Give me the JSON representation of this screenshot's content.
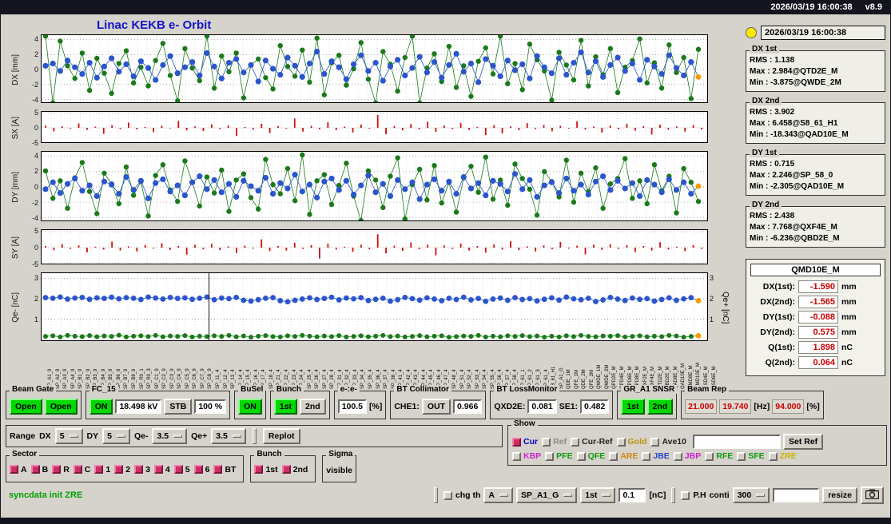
{
  "titlebar": {
    "datetime": "2026/03/19 16:00:38",
    "version": "v8.9"
  },
  "header": {
    "title": "Linac KEKB e- Orbit",
    "timestamp": "2026/03/19 16:00:38"
  },
  "stats": [
    {
      "label": "DX 1st",
      "rms": "RMS : 1.138",
      "max": "Max : 2.984@QTD2E_M",
      "min": "Min : -3.875@QWDE_2M"
    },
    {
      "label": "DX 2nd",
      "rms": "RMS : 3.902",
      "max": "Max : 6.458@S8_61_H1",
      "min": "Min : -18.343@QAD10E_M"
    },
    {
      "label": "DY 1st",
      "rms": "RMS : 0.715",
      "max": "Max : 2.246@SP_58_0",
      "min": "Min : -2.305@QAD10E_M"
    },
    {
      "label": "DY 2nd",
      "rms": "RMS : 2.438",
      "max": "Max : 7.768@QXF4E_M",
      "min": "Min : -6.236@QBD2E_M"
    }
  ],
  "monitor": {
    "name": "QMD10E_M",
    "rows": [
      {
        "label": "DX(1st):",
        "value": "-1.590",
        "unit": "mm"
      },
      {
        "label": "DX(2nd):",
        "value": "-1.565",
        "unit": "mm"
      },
      {
        "label": "DY(1st):",
        "value": "-0.088",
        "unit": "mm"
      },
      {
        "label": "DY(2nd):",
        "value": "0.575",
        "unit": "mm"
      },
      {
        "label": "Q(1st):",
        "value": "1.898",
        "unit": "nC"
      },
      {
        "label": "Q(2nd):",
        "value": "0.064",
        "unit": "nC"
      }
    ]
  },
  "controls": {
    "beam_gate": {
      "label": "Beam Gate",
      "open1": "Open",
      "open2": "Open"
    },
    "fc15": {
      "label": "FC_15",
      "on": "ON",
      "kv": "18.498 kV",
      "stb": "STB",
      "pct": "100 %"
    },
    "busel": {
      "label": "BuSel",
      "on": "ON"
    },
    "bunch_sel": {
      "label": "Bunch",
      "b1": "1st",
      "b2": "2nd"
    },
    "ee": {
      "label": "e-:e-",
      "value": "100.5",
      "unit": "[%]"
    },
    "bt_collimator": {
      "label": "BT Collimator",
      "che1": "CHE1:",
      "out": "OUT",
      "value": "0.966"
    },
    "bt_loss": {
      "label": "BT LossMonitor",
      "qxd2e": "QXD2E:",
      "qxd2e_value": "0.081",
      "se1": "SE1:",
      "se1_value": "0.482"
    },
    "gr_snsr": {
      "label": "GR_A1 SNSR",
      "b1": "1st",
      "b2": "2nd"
    },
    "beam_rep": {
      "label": "Beam Rep",
      "v1": "21.000",
      "v2": "19.740",
      "hz": "[Hz]",
      "v3": "94.000",
      "pct": "[%]"
    },
    "range": {
      "label": "Range",
      "dx_label": "DX",
      "dx": "5",
      "dy_label": "DY",
      "dy": "5",
      "qem_label": "Qe-",
      "qem": "3.5",
      "qep_label": "Qe+",
      "qep": "3.5",
      "replot": "Replot"
    },
    "sector": {
      "label": "Sector",
      "items": [
        "A",
        "B",
        "R",
        "C",
        "1",
        "2",
        "3",
        "4",
        "5",
        "6",
        "BT"
      ]
    },
    "bunch_chk": {
      "label": "Bunch",
      "items": [
        "1st",
        "2nd"
      ]
    },
    "sigma": {
      "label": "Sigma",
      "visible": "visible"
    },
    "show": {
      "label": "Show",
      "row1": [
        {
          "label": "Cur",
          "color": "#0000cc",
          "checked": true
        },
        {
          "label": "Ref",
          "color": "#8a8a8a"
        },
        {
          "label": "Cur-Ref",
          "color": "#222222"
        },
        {
          "label": "Gold",
          "color": "#b8960c"
        },
        {
          "label": "Ave10",
          "color": "#222222"
        }
      ],
      "set_ref": "Set Ref",
      "row2": [
        {
          "label": "KBP",
          "color": "#cc22cc"
        },
        {
          "label": "PFE",
          "color": "#119911"
        },
        {
          "label": "QFE",
          "color": "#119911"
        },
        {
          "label": "ARE",
          "color": "#cc8811"
        },
        {
          "label": "JBE",
          "color": "#2244cc"
        },
        {
          "label": "JBP",
          "color": "#cc22cc"
        },
        {
          "label": "RFE",
          "color": "#119911"
        },
        {
          "label": "SFE",
          "color": "#119911"
        },
        {
          "label": "ZRE",
          "color": "#c8b400"
        }
      ]
    }
  },
  "statusbar": {
    "message": "syncdata init ZRE",
    "chg_th_label": "chg th",
    "monitor_select": "A",
    "device_select": "SP_A1_G",
    "bunch_select": "1st",
    "threshold": "0.1",
    "threshold_unit": "[nC]",
    "ph_label": "P.H",
    "conti_label": "conti",
    "count_select": "300",
    "resize_label": "resize"
  },
  "xaxis_labels": [
    "SP_A1_9",
    "SP_A2_9",
    "SP_A3_9",
    "SP_A4_9",
    "SP_B1_9",
    "SP_B2_9",
    "SP_B3_9",
    "SP_B4_9",
    "SP_B5_9",
    "SP_B6_9",
    "SP_B7_9",
    "SP_B8_9",
    "SP_R0_1",
    "SP_R0_3",
    "SP_C1_9",
    "SP_C2_9",
    "SP_C3_9",
    "SP_C4_9",
    "SP_C5_9",
    "SP_C6_9",
    "SP_C7_9",
    "SP_C8_9",
    "SP_11_4",
    "SP_12_4",
    "SP_13_4",
    "SP_14_4",
    "SP_15_4",
    "SP_16_4",
    "SP_17_4",
    "SP_18_4",
    "SP_21_4",
    "SP_22_4",
    "SP_23_4",
    "SP_24_4",
    "SP_25_4",
    "SP_26_4",
    "SP_27_4",
    "SP_28_4",
    "SP_31_4",
    "SP_32_4",
    "SP_33_4",
    "SP_34_4",
    "SP_35_4",
    "SP_36_4",
    "SP_37_4",
    "SP_38_4",
    "SP_41_4",
    "SP_42_4",
    "SP_43_4",
    "SP_44_4",
    "SP_45_4",
    "SP_46_4",
    "SP_47_4",
    "SP_48_4",
    "SP_51_4",
    "SP_52_4",
    "SP_53_4",
    "SP_54_4",
    "SP_55_4",
    "SP_56_4",
    "SP_57_4",
    "SP_58_4",
    "SP_61_1",
    "SP_61_2",
    "SP_61_3",
    "SP_61_4",
    "S8_61_H1",
    "SP_A1_G",
    "QDE_1M",
    "QFE_1M",
    "QDE_2M",
    "QFE_2M",
    "QWDE_1M",
    "QWDE_2M",
    "QPD2E_M",
    "QPD4E_M",
    "QPD6E_M",
    "QPD8E_M",
    "QXF2E_M",
    "QXF4E_M",
    "QTD2E_M",
    "QBD2E_M",
    "QAD8E_M",
    "QAD10E_M",
    "QMD8E_M",
    "QMD10E_M",
    "QSD4E_M",
    "QSD6E_M"
  ],
  "chart_data": [
    {
      "id": "dx",
      "type": "line-scatter",
      "ylabel": "DX [mm]",
      "ylim": [
        -4.6,
        4.6
      ],
      "yticks": [
        4,
        2,
        0,
        -2,
        -4
      ],
      "series": [
        {
          "name": "DX 2nd",
          "color": "#1a7a1a",
          "marker": 3.2,
          "values": [
            4.5,
            -4.5,
            3.8,
            0.5,
            -1.2,
            2.2,
            -2.8,
            1.5,
            -0.5,
            -3.2,
            0.8,
            2.5,
            -1.8,
            0.3,
            -2.2,
            1.2,
            3.5,
            -0.8,
            -4.2,
            2.8,
            0.2,
            -1.5,
            4.5,
            -2.5,
            1.8,
            -0.3,
            2.2,
            -3.8,
            0.6,
            1.4,
            -1.1,
            -2.6,
            3.2,
            0.4,
            -0.9,
            2.6,
            -1.7,
            4.2,
            -3.4,
            0.9,
            1.9,
            -2.1,
            0.1,
            3.6,
            -1.3,
            -4.5,
            2.4,
            0.7,
            -2.9,
            1.6,
            4.5,
            -4.5,
            0.2,
            2.1,
            -1.6,
            3.1,
            -2.4,
            0.5,
            -3.6,
            1.1,
            2.9,
            -0.6,
            4.5,
            -1.9,
            0.8,
            -2.7,
            3.4,
            1.3,
            -0.2,
            -4.1,
            2.3,
            0.6,
            -1.4,
            3.9,
            -2.2,
            1.7,
            -0.7,
            2.8,
            -3.1,
            0.3,
            1.2,
            4.1,
            -1.8,
            0.9,
            -2.5,
            3.3,
            -0.4,
            1.6,
            -3.9,
            2.7
          ]
        },
        {
          "name": "DX 1st",
          "color": "#2a55cc",
          "marker": 3.6,
          "end_orange": true,
          "values": [
            0.5,
            0.8,
            -0.2,
            1.2,
            0.3,
            -0.6,
            0.9,
            -1.1,
            0.4,
            1.5,
            -0.3,
            0.7,
            -0.9,
            1.1,
            0.2,
            -1.4,
            0.6,
            1.8,
            -0.5,
            0.3,
            1.0,
            -0.8,
            2.2,
            0.4,
            -1.2,
            0.9,
            1.4,
            -0.4,
            0.6,
            -1.6,
            1.2,
            0.1,
            -0.7,
            1.6,
            0.5,
            -1.0,
            0.8,
            2.4,
            -0.6,
            1.1,
            0.3,
            -1.3,
            0.7,
            1.9,
            -0.2,
            0.9,
            -1.5,
            0.4,
            1.3,
            -0.8,
            0.2,
            1.7,
            -0.4,
            1.0,
            -1.1,
            0.6,
            2.1,
            -0.3,
            0.8,
            -1.7,
            1.4,
            0.5,
            -0.9,
            1.2,
            -0.1,
            0.7,
            -1.2,
            1.8,
            0.3,
            -0.5,
            1.5,
            -0.7,
            0.9,
            2.3,
            -0.4,
            1.1,
            -1.0,
            0.6,
            1.6,
            -0.2,
            0.8,
            -1.4,
            1.3,
            0.4,
            -0.6,
            1.9,
            0.2,
            -0.8,
            1.0,
            -1.0
          ]
        }
      ]
    },
    {
      "id": "sx",
      "type": "bar",
      "ylabel": "SX [A]",
      "ylim": [
        -5.5,
        5.5
      ],
      "yticks": [
        5,
        0,
        -5
      ],
      "color": "#cc1111",
      "values": [
        0.8,
        -1.2,
        0.5,
        -0.3,
        1.5,
        -0.7,
        0.4,
        -2.1,
        0.9,
        -0.4,
        1.8,
        -0.6,
        0.3,
        -1.5,
        0.7,
        -0.2,
        2.4,
        -0.9,
        0.5,
        -1.1,
        1.2,
        -0.4,
        0.8,
        -2.8,
        0.3,
        -0.6,
        1.4,
        -1.8,
        0.6,
        -0.3,
        3.2,
        -1.3,
        0.7,
        -0.5,
        1.9,
        -0.8,
        0.4,
        -1.6,
        1.1,
        -0.3,
        4.4,
        -2.2,
        0.6,
        -0.9,
        1.3,
        -0.5,
        2.1,
        -1.4,
        0.8,
        -0.4,
        1.7,
        -0.7,
        0.3,
        -2.5,
        0.9,
        -1.9,
        0.5,
        -0.8,
        1.6,
        -0.4,
        1.0,
        -1.2,
        0.7,
        -0.3,
        2.2,
        -0.6,
        0.4,
        -1.7,
        0.8,
        -0.5,
        1.4,
        -1.0,
        0.6,
        -2.3,
        1.1,
        -0.7,
        0.5,
        -1.3,
        0.9,
        -0.6
      ]
    },
    {
      "id": "dy",
      "type": "line-scatter",
      "ylabel": "DY [mm]",
      "ylim": [
        -4.6,
        4.6
      ],
      "yticks": [
        4,
        2,
        0,
        -2,
        -4
      ],
      "series": [
        {
          "name": "DY 2nd",
          "color": "#1a7a1a",
          "marker": 3.2,
          "values": [
            2.1,
            -1.5,
            0.8,
            -2.8,
            1.2,
            3.2,
            -0.6,
            -3.5,
            1.8,
            0.4,
            -2.2,
            2.6,
            -1.1,
            0.7,
            -3.8,
            1.5,
            2.9,
            -0.4,
            -1.9,
            3.4,
            0.6,
            -2.5,
            1.3,
            -0.8,
            2.2,
            -3.2,
            0.9,
            1.7,
            -1.4,
            -2.9,
            3.6,
            0.3,
            -0.9,
            2.4,
            -1.8,
            4.2,
            -3.6,
            0.8,
            1.6,
            -2.3,
            0.2,
            3.1,
            -1.2,
            -4.4,
            2.1,
            0.9,
            -2.7,
            1.4,
            3.8,
            -4.2,
            0.3,
            2.3,
            -1.7,
            2.8,
            -2.1,
            0.6,
            -3.3,
            1.2,
            2.7,
            -0.7,
            3.9,
            -1.6,
            0.9,
            -2.4,
            3.0,
            1.1,
            -0.3,
            -3.7,
            2.0,
            0.7,
            -1.3,
            3.5,
            -2.0,
            1.8,
            -0.6,
            2.5,
            -2.8,
            0.4,
            1.1,
            3.7,
            -1.5,
            0.8,
            -2.2,
            2.9,
            -0.5,
            1.4,
            -3.4,
            2.4,
            0.6,
            -1.9
          ]
        },
        {
          "name": "DY 1st",
          "color": "#2a55cc",
          "marker": 3.6,
          "end_orange": true,
          "values": [
            -0.3,
            0.6,
            -0.8,
            0.4,
            1.1,
            -0.5,
            0.2,
            -1.2,
            0.7,
            0.3,
            -0.9,
            1.3,
            -0.4,
            0.8,
            -1.5,
            0.5,
            1.0,
            -0.6,
            0.2,
            -1.1,
            0.6,
            1.4,
            -0.3,
            0.9,
            -0.7,
            0.4,
            -1.3,
            0.8,
            0.1,
            -0.5,
            1.2,
            -0.9,
            0.5,
            -0.2,
            1.6,
            -0.6,
            0.3,
            -1.4,
            0.7,
            1.1,
            -0.4,
            0.8,
            -1.0,
            0.2,
            1.5,
            -0.7,
            0.4,
            -1.2,
            0.9,
            -0.3,
            0.6,
            -1.6,
            0.3,
            1.0,
            -0.5,
            0.7,
            -0.9,
            1.3,
            -0.2,
            0.5,
            -1.1,
            0.8,
            0.4,
            -0.6,
            1.7,
            -0.3,
            0.9,
            -1.3,
            0.2,
            0.6,
            -0.8,
            1.1,
            -0.5,
            0.3,
            -1.0,
            0.7,
            1.4,
            -0.4,
            0.8,
            -0.2,
            0.5,
            -1.2,
            0.9,
            0.3,
            -0.7,
            1.0,
            -0.4,
            0.6,
            -0.9,
            0.1
          ]
        }
      ]
    },
    {
      "id": "sy",
      "type": "bar",
      "ylabel": "SY [A]",
      "ylim": [
        -5.5,
        5.5
      ],
      "yticks": [
        5,
        0,
        -5
      ],
      "color": "#cc1111",
      "values": [
        0.5,
        -0.8,
        1.1,
        -0.4,
        0.7,
        -1.5,
        0.3,
        -0.6,
        1.9,
        -0.9,
        0.4,
        -1.2,
        0.8,
        -0.3,
        1.4,
        -0.7,
        0.5,
        -2.2,
        0.9,
        -0.5,
        1.2,
        -0.8,
        0.4,
        -1.7,
        0.6,
        -0.3,
        2.6,
        -1.1,
        0.5,
        -0.9,
        1.5,
        -0.4,
        0.8,
        -3.4,
        1.2,
        -0.6,
        0.3,
        -1.3,
        0.9,
        -0.5,
        4.2,
        -1.8,
        0.6,
        -1.0,
        1.6,
        -0.5,
        0.9,
        -2.4,
        0.7,
        -0.4,
        1.3,
        -0.9,
        0.5,
        -1.6,
        1.0,
        -0.6,
        2.0,
        -0.8,
        0.4,
        -1.2,
        0.7,
        -0.5,
        1.8,
        -0.3,
        0.6,
        -2.1,
        0.9,
        -0.7,
        1.1,
        -0.4,
        0.8,
        -1.4,
        0.5,
        -0.9,
        1.7,
        -0.6,
        0.3,
        -1.1,
        0.8,
        -0.4
      ]
    },
    {
      "id": "q",
      "type": "line-scatter",
      "ylabel": "Qe- [nC]",
      "ylabel_right": "Qe+ [nC]",
      "ylim": [
        -0.12,
        3.25
      ],
      "yticks": [
        3,
        2,
        1
      ],
      "yticks_right": [
        3,
        2,
        1
      ],
      "cursor_x": 0.251,
      "series": [
        {
          "name": "Qe- 1st",
          "color": "#2a55cc",
          "marker": 3.4,
          "end_orange": true,
          "values": [
            2.05,
            2.02,
            2.08,
            1.98,
            2.03,
            2.06,
            1.97,
            2.04,
            2.01,
            2.07,
            1.99,
            2.05,
            2.02,
            1.96,
            2.08,
            2.03,
            1.98,
            2.06,
            2.01,
            2.04,
            1.97,
            2.02,
            2.08,
            1.95,
            2.03,
            2.0,
            2.06,
            1.92,
            1.88,
            1.95,
            2.02,
            2.05,
            1.9,
            1.85,
            1.92,
            1.98,
            2.04,
            1.96,
            2.01,
            2.07,
            1.94,
            2.03,
            1.99,
            2.05,
            1.91,
            1.97,
            2.02,
            1.88,
            1.95,
            2.06,
            2.0,
            1.93,
            2.04,
            1.98,
            1.9,
            2.02,
            1.96,
            2.07,
            1.94,
            2.01,
            1.87,
            1.98,
            2.03,
            1.92,
            2.05,
            1.96,
            2.0,
            1.89,
            1.97,
            2.04,
            1.93,
            2.08,
            1.99,
            1.95,
            2.02,
            1.86,
            1.94,
            2.06,
            1.98,
            1.91,
            2.03,
            1.97,
            2.0,
            1.88,
            1.96,
            2.04,
            1.92,
            1.99,
            2.05,
            1.9
          ]
        },
        {
          "name": "Qe- 2nd",
          "color": "#1a7a1a",
          "marker": 3.0,
          "end_orange": true,
          "values": [
            0.15,
            0.18,
            0.12,
            0.2,
            0.16,
            0.14,
            0.19,
            0.13,
            0.17,
            0.15,
            0.21,
            0.12,
            0.16,
            0.18,
            0.14,
            0.2,
            0.13,
            0.17,
            0.15,
            0.19,
            0.12,
            0.16,
            0.14,
            0.18,
            0.15,
            0.2,
            0.13,
            0.17,
            0.11,
            0.16,
            0.19,
            0.14,
            0.12,
            0.18,
            0.15,
            0.2,
            0.16,
            0.13,
            0.17,
            0.14,
            0.19,
            0.12,
            0.15,
            0.18,
            0.13,
            0.16,
            0.2,
            0.14,
            0.17,
            0.12,
            0.15,
            0.19,
            0.13,
            0.16,
            0.18,
            0.11,
            0.14,
            0.17,
            0.15,
            0.2,
            0.12,
            0.16,
            0.13,
            0.18,
            0.15,
            0.19,
            0.14,
            0.17,
            0.11,
            0.16,
            0.12,
            0.18,
            0.14,
            0.2,
            0.15,
            0.13,
            0.17,
            0.16,
            0.19,
            0.12,
            0.15,
            0.18,
            0.13,
            0.16,
            0.14,
            0.2,
            0.17,
            0.11,
            0.15,
            0.18
          ]
        }
      ]
    }
  ]
}
